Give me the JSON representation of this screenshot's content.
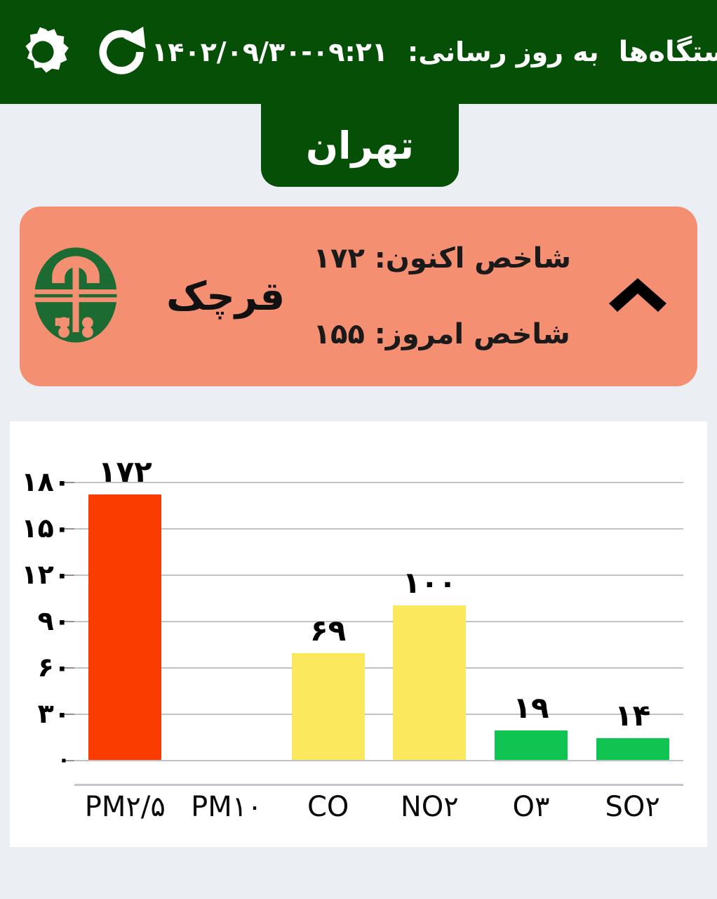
{
  "appbar": {
    "settings_icon": "gear-icon",
    "refresh_icon": "refresh-icon",
    "title": "لیست ایستگاه‌ها",
    "update_label": "به روز رسانی:",
    "update_datetime": "۱۴۰۲/۰۹/۳۰-۰۹:۲۱",
    "logo_icon": "doe-logo-icon",
    "bg_color": "#054F06",
    "text_color": "#FFFFFF"
  },
  "tabs": {
    "items": [
      {
        "label": "تهران",
        "selected": true
      }
    ]
  },
  "station": {
    "name": "قرچک",
    "logo_icon": "doe-logo-icon",
    "now_label": "شاخص اکنون:",
    "now_value": "۱۷۲",
    "today_label": "شاخص امروز:",
    "today_value": "۱۵۵",
    "trend_icon": "chevron-up-icon",
    "card_color": "#F58F72"
  },
  "chart_data": {
    "type": "bar",
    "title": "",
    "xlabel": "",
    "ylabel": "",
    "ylim": [
      0,
      180
    ],
    "grid": true,
    "legend": "none",
    "categories": [
      "PM۲/۵",
      "PM۱۰",
      "CO",
      "NO۲",
      "O۳",
      "SO۲"
    ],
    "values": [
      172,
      null,
      69,
      100,
      19,
      14
    ],
    "value_labels": [
      "۱۷۲",
      "",
      "۶۹",
      "۱۰۰",
      "۱۹",
      "۱۴"
    ],
    "bar_colors": [
      "#FA3C00",
      "",
      "#FBE85C",
      "#FBE85C",
      "#0FC451",
      "#0FC451"
    ],
    "ytick_labels": [
      "۱۸۰",
      "۱۵۰",
      "۱۲۰",
      "۹۰",
      "۶۰",
      "۳۰",
      "۰"
    ],
    "ytick_values": [
      180,
      150,
      120,
      90,
      60,
      30,
      0
    ]
  },
  "palette": {
    "page_bg": "#EBEEF3",
    "green": "#054F06",
    "salmon": "#F58F72",
    "red": "#FA3C00",
    "yellow": "#FBE85C",
    "green_bar": "#0FC451",
    "grid": "#BFC3C7"
  }
}
